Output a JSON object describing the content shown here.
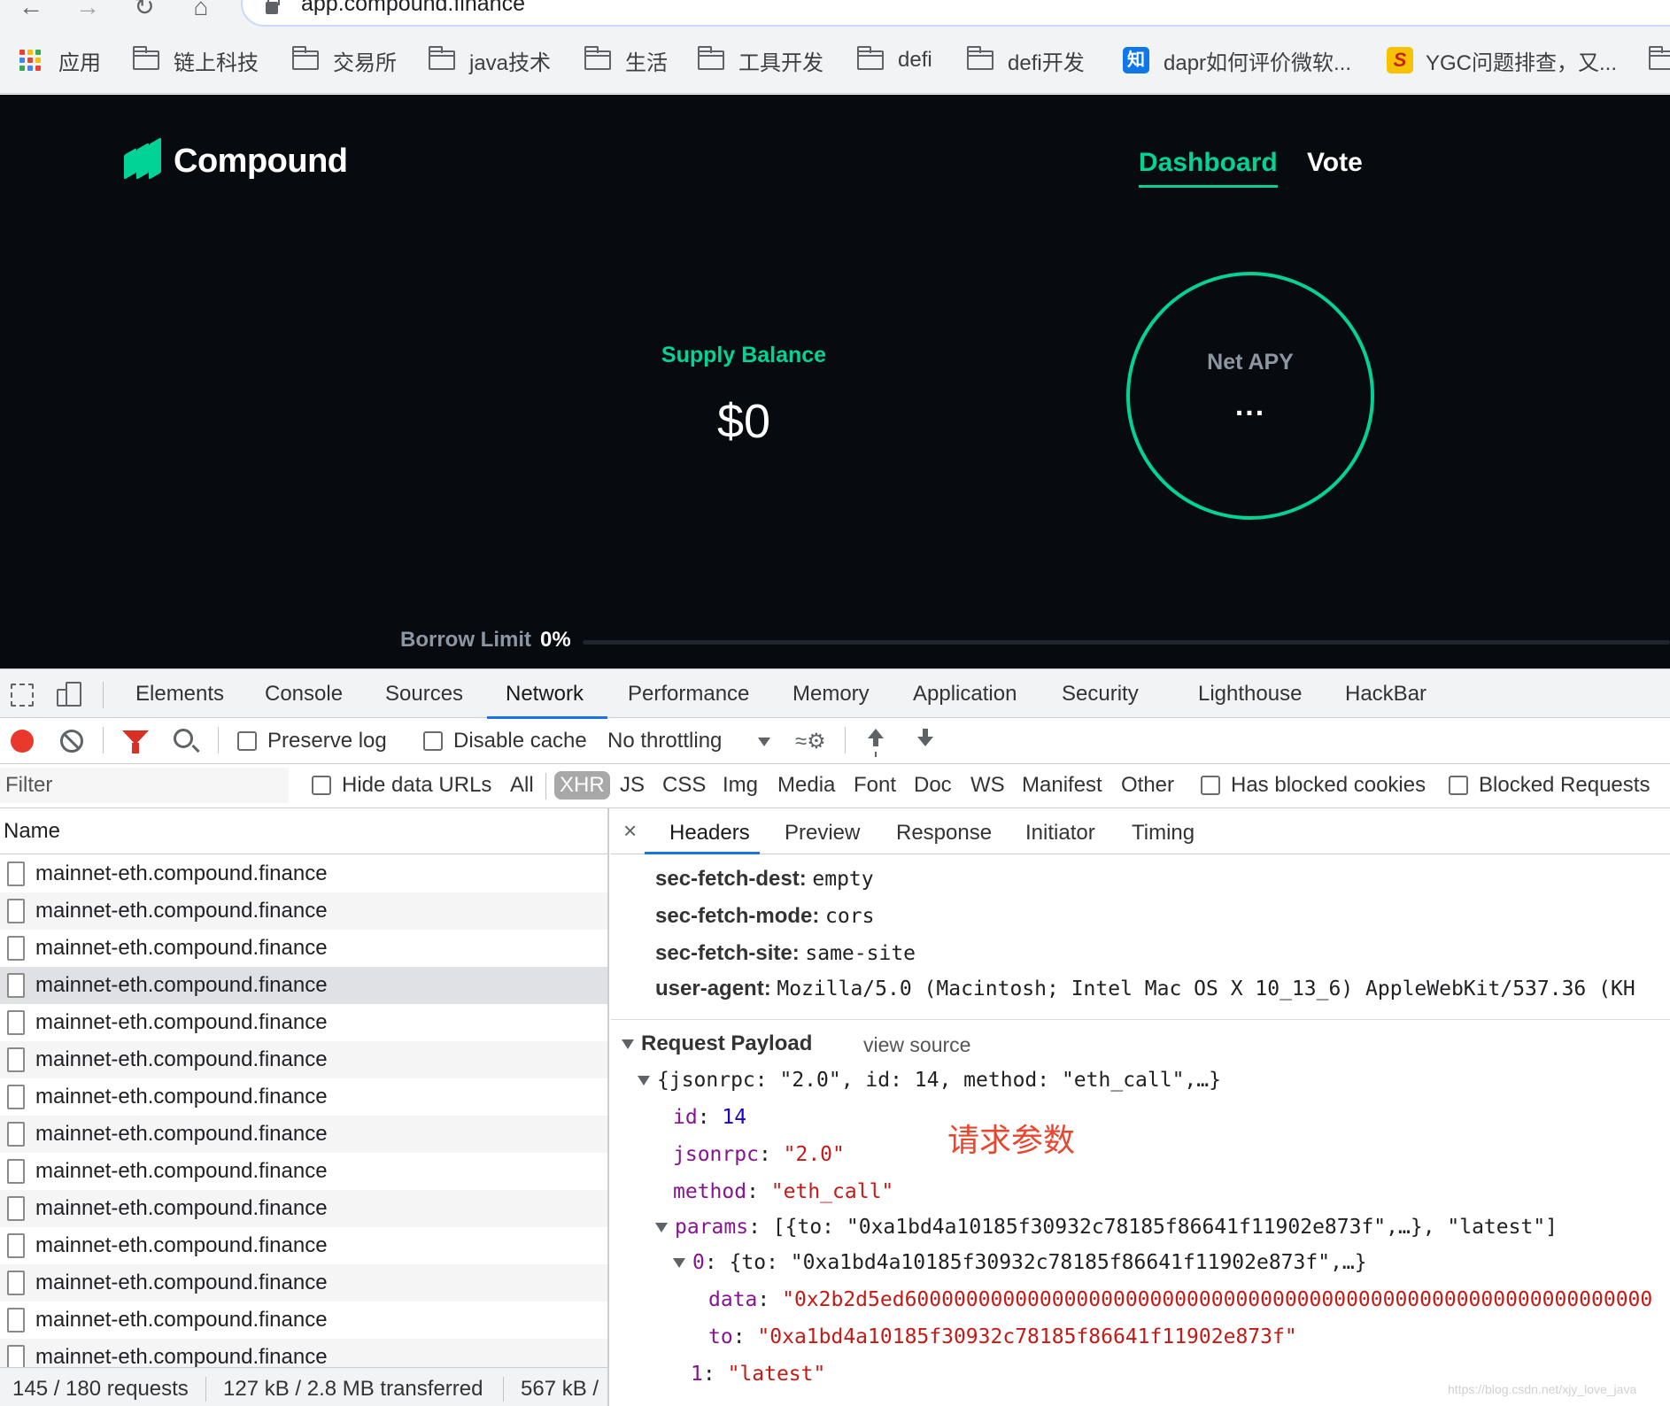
{
  "browser": {
    "url": "app.compound.finance",
    "bookmarks": [
      {
        "label": "应用",
        "type": "apps"
      },
      {
        "label": "链上科技",
        "type": "folder"
      },
      {
        "label": "交易所",
        "type": "folder"
      },
      {
        "label": "java技术",
        "type": "folder"
      },
      {
        "label": "生活",
        "type": "folder"
      },
      {
        "label": "工具开发",
        "type": "folder"
      },
      {
        "label": "defi",
        "type": "folder"
      },
      {
        "label": "defi开发",
        "type": "folder"
      },
      {
        "label": "dapr如何评价微软...",
        "type": "zhihu",
        "icon_text": "知"
      },
      {
        "label": "YGC问题排查，又...",
        "type": "site",
        "icon_text": "S"
      }
    ]
  },
  "app": {
    "brand": "Compound",
    "brand_color": "#00d395",
    "nav": {
      "dashboard": "Dashboard",
      "vote": "Vote"
    },
    "supply_label": "Supply Balance",
    "supply_value": "$0",
    "apy_label": "Net APY",
    "apy_value": "...",
    "borrow_label": "Borrow Limit",
    "borrow_value": "0%",
    "borrow_fraction": 0
  },
  "devtools": {
    "tabs": [
      "Elements",
      "Console",
      "Sources",
      "Network",
      "Performance",
      "Memory",
      "Application",
      "Security",
      "Lighthouse",
      "HackBar"
    ],
    "active_tab": "Network",
    "toolbar": {
      "preserve_log": "Preserve log",
      "disable_cache": "Disable cache",
      "throttling": "No throttling"
    },
    "filter": {
      "placeholder": "Filter",
      "hide_data_urls": "Hide data URLs",
      "types": [
        "All",
        "XHR",
        "JS",
        "CSS",
        "Img",
        "Media",
        "Font",
        "Doc",
        "WS",
        "Manifest",
        "Other"
      ],
      "active_type": "XHR",
      "has_blocked_cookies": "Has blocked cookies",
      "blocked_requests": "Blocked Requests"
    },
    "requests": {
      "column": "Name",
      "rows": [
        "mainnet-eth.compound.finance",
        "mainnet-eth.compound.finance",
        "mainnet-eth.compound.finance",
        "mainnet-eth.compound.finance",
        "mainnet-eth.compound.finance",
        "mainnet-eth.compound.finance",
        "mainnet-eth.compound.finance",
        "mainnet-eth.compound.finance",
        "mainnet-eth.compound.finance",
        "mainnet-eth.compound.finance",
        "mainnet-eth.compound.finance",
        "mainnet-eth.compound.finance",
        "mainnet-eth.compound.finance",
        "mainnet-eth.compound.finance"
      ],
      "selected_index": 3,
      "status": {
        "requests": "145 / 180 requests",
        "transferred": "127 kB / 2.8 MB transferred",
        "resources": "567 kB /"
      }
    },
    "detail": {
      "close": "×",
      "tabs": [
        "Headers",
        "Preview",
        "Response",
        "Initiator",
        "Timing"
      ],
      "active_tab": "Headers",
      "headers": [
        {
          "name": "sec-fetch-dest:",
          "value": "empty"
        },
        {
          "name": "sec-fetch-mode:",
          "value": "cors"
        },
        {
          "name": "sec-fetch-site:",
          "value": "same-site"
        },
        {
          "name": "user-agent:",
          "value": "Mozilla/5.0 (Macintosh; Intel Mac OS X 10_13_6) AppleWebKit/537.36 (KH"
        }
      ],
      "payload_title": "Request Payload",
      "view_source": "view source",
      "payload_summary": "{jsonrpc: \"2.0\", id: 14, method: \"eth_call\",…}",
      "id_key": "id",
      "id_value": "14",
      "jsonrpc_key": "jsonrpc",
      "jsonrpc_value": "\"2.0\"",
      "method_key": "method",
      "method_value": "\"eth_call\"",
      "params_key": "params",
      "params_summary": "[{to: \"0xa1bd4a10185f30932c78185f86641f11902e873f\",…}, \"latest\"]",
      "p0_key": "0",
      "p0_summary": "{to: \"0xa1bd4a10185f30932c78185f86641f11902e873f\",…}",
      "data_key": "data",
      "data_value": "\"0x2b2d5ed6000000000000000000000000000000000000000000000000000000000000",
      "to_key": "to",
      "to_value": "\"0xa1bd4a10185f30932c78185f86641f11902e873f\"",
      "p1_key": "1",
      "p1_value": "\"latest\"",
      "annotation": "请求参数",
      "watermark": "https://blog.csdn.net/xjy_love_java"
    }
  }
}
